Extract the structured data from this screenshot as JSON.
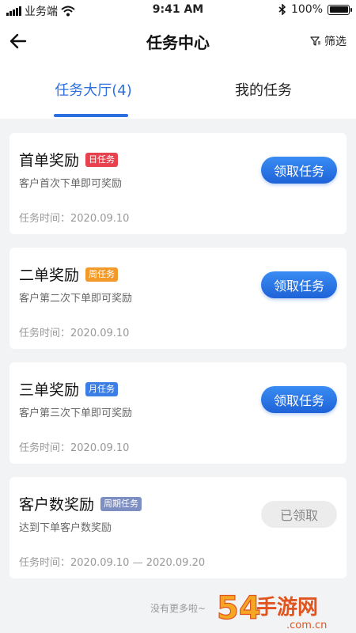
{
  "status_bar": {
    "carrier": "业务端",
    "time": "9:41 AM",
    "battery": "100%"
  },
  "nav": {
    "title": "任务中心",
    "filter_label": "筛选"
  },
  "tabs": [
    {
      "label": "任务大厅(4)",
      "active": true
    },
    {
      "label": "我的任务",
      "active": false
    }
  ],
  "tasks": [
    {
      "title": "首单奖励",
      "badge": "日任务",
      "badge_color": "#e8424f",
      "desc": "客户首次下单即可奖励",
      "time": "任务时间：2020.09.10",
      "button": "领取任务",
      "enabled": true
    },
    {
      "title": "二单奖励",
      "badge": "周任务",
      "badge_color": "#f39a2b",
      "desc": "客户第二次下单即可奖励",
      "time": "任务时间：2020.09.10",
      "button": "领取任务",
      "enabled": true
    },
    {
      "title": "三单奖励",
      "badge": "月任务",
      "badge_color": "#3b7fe6",
      "desc": "客户第三次下单即可奖励",
      "time": "任务时间：2020.09.10",
      "button": "领取任务",
      "enabled": true
    },
    {
      "title": "客户数奖励",
      "badge": "周期任务",
      "badge_color": "#7d8fc2",
      "desc": "达到下单客户数奖励",
      "time": "任务时间：2020.09.10 — 2020.09.20",
      "button": "已领取",
      "enabled": false
    }
  ],
  "footer": {
    "no_more": "没有更多啦~"
  },
  "watermark": {
    "text": "54手游网",
    "domain": ".com.cn"
  }
}
